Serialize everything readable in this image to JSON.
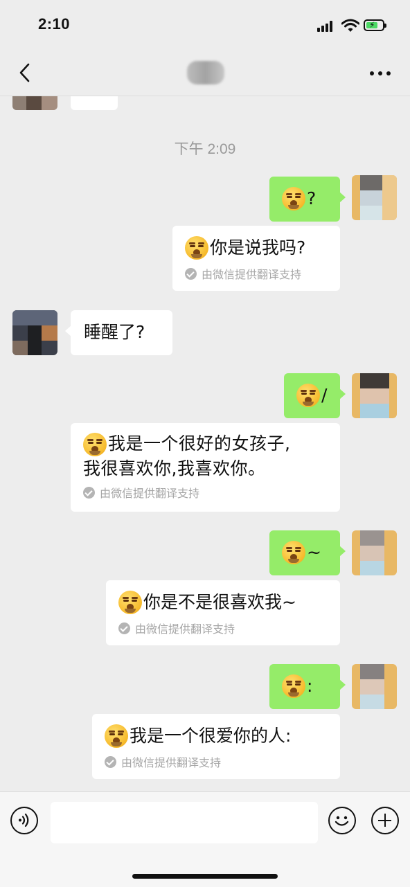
{
  "status_bar": {
    "time": "2:10"
  },
  "nav": {
    "back_icon": "chevron-left-icon",
    "more_icon": "more-dots-icon"
  },
  "chat": {
    "timestamp": "下午 2:09",
    "messages": [
      {
        "side": "right",
        "type": "sent",
        "text": "?"
      },
      {
        "side": "right",
        "type": "translation",
        "text": "你是说我吗?",
        "footer": "由微信提供翻译支持"
      },
      {
        "side": "left",
        "type": "received",
        "text": "睡醒了?"
      },
      {
        "side": "right",
        "type": "sent",
        "text": "/"
      },
      {
        "side": "right",
        "type": "translation",
        "line1": "我是一个很好的女孩子,",
        "line2": "我很喜欢你,我喜欢你。",
        "footer": "由微信提供翻译支持"
      },
      {
        "side": "right",
        "type": "sent",
        "text": "~"
      },
      {
        "side": "right",
        "type": "translation",
        "text": "你是不是很喜欢我~",
        "footer": "由微信提供翻译支持"
      },
      {
        "side": "right",
        "type": "sent",
        "text": ":"
      },
      {
        "side": "right",
        "type": "translation",
        "text": "我是一个很爱你的人:",
        "footer": "由微信提供翻译支持"
      }
    ]
  },
  "input_bar": {
    "voice_icon": "voice-icon",
    "input_value": "",
    "emoji_icon": "emoji-icon",
    "plus_icon": "plus-icon"
  },
  "colors": {
    "sent_bubble": "#95ec69",
    "received_bubble": "#ffffff",
    "background": "#ededed"
  }
}
